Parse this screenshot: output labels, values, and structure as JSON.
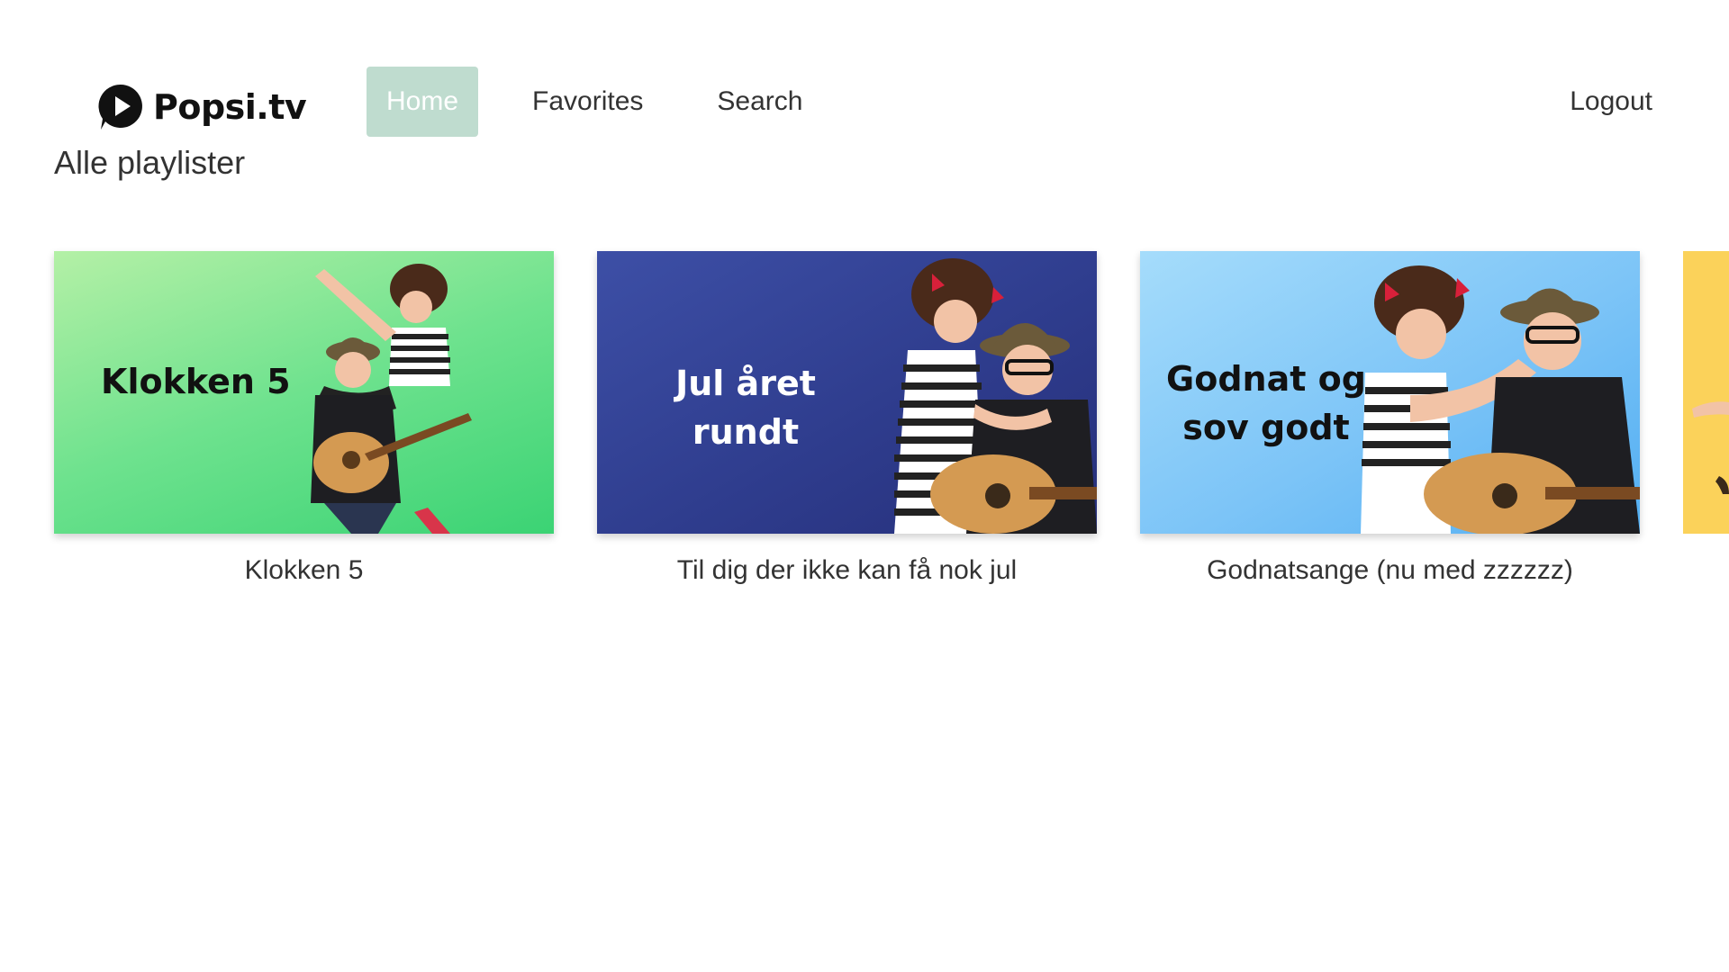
{
  "brand": {
    "name": "Popsi.tv"
  },
  "nav": {
    "items": [
      {
        "label": "Home",
        "active": true
      },
      {
        "label": "Favorites",
        "active": false
      },
      {
        "label": "Search",
        "active": false
      }
    ],
    "logout_label": "Logout"
  },
  "section": {
    "title": "Alle playlister"
  },
  "playlists": [
    {
      "thumb_title": "Klokken 5",
      "label": "Klokken 5"
    },
    {
      "thumb_title_line1": "Jul året",
      "thumb_title_line2": "rundt",
      "label": "Til dig der ikke kan få nok jul"
    },
    {
      "thumb_title_line1": "Godnat og",
      "thumb_title_line2": "sov godt",
      "label": "Godnatsange (nu med zzzzzz)"
    }
  ],
  "colors": {
    "nav_active_bg": "#bfdccf",
    "card1_bg": [
      "#b4f0a6",
      "#3bd374"
    ],
    "card2_bg": [
      "#3d4fa6",
      "#262f7a"
    ],
    "card3_bg": [
      "#a5dcfb",
      "#52aef2"
    ],
    "card4_bg": "#fbd25a"
  },
  "icons": {
    "logo": "play-bubble-icon"
  }
}
